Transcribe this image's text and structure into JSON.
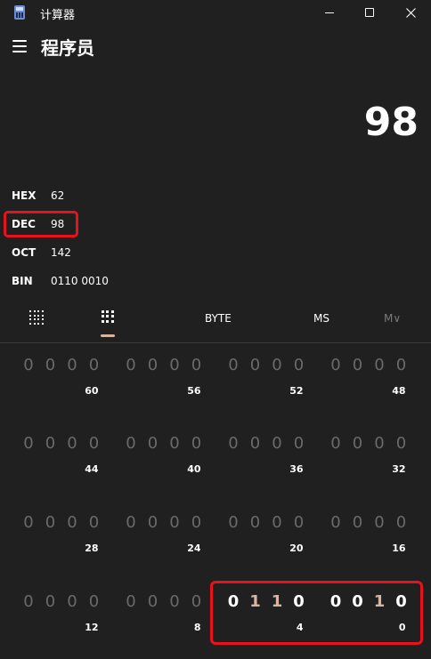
{
  "window": {
    "title": "计算器",
    "app_icon": "calculator-icon",
    "controls": [
      "minimize-icon",
      "maximize-icon",
      "close-icon"
    ]
  },
  "header": {
    "menu_icon": "hamburger-menu-icon",
    "mode_title": "程序员"
  },
  "display": {
    "value": "98"
  },
  "radix": [
    {
      "name": "HEX",
      "value": "62"
    },
    {
      "name": "DEC",
      "value": "98"
    },
    {
      "name": "OCT",
      "value": "142"
    },
    {
      "name": "BIN",
      "value": "0110 0010"
    }
  ],
  "toolbar": {
    "keypad_icon": "full-keypad-icon",
    "bit_toggle_icon": "bit-toggling-keypad-icon",
    "word_size": "BYTE",
    "memory_store": "MS",
    "memory_menu": "M∨"
  },
  "bit_grid": {
    "rows": [
      {
        "groups": [
          {
            "bits": [
              "0",
              "0",
              "0",
              "0"
            ],
            "label": "60"
          },
          {
            "bits": [
              "0",
              "0",
              "0",
              "0"
            ],
            "label": "56"
          },
          {
            "bits": [
              "0",
              "0",
              "0",
              "0"
            ],
            "label": "52"
          },
          {
            "bits": [
              "0",
              "0",
              "0",
              "0"
            ],
            "label": "48"
          }
        ]
      },
      {
        "groups": [
          {
            "bits": [
              "0",
              "0",
              "0",
              "0"
            ],
            "label": "44"
          },
          {
            "bits": [
              "0",
              "0",
              "0",
              "0"
            ],
            "label": "40"
          },
          {
            "bits": [
              "0",
              "0",
              "0",
              "0"
            ],
            "label": "36"
          },
          {
            "bits": [
              "0",
              "0",
              "0",
              "0"
            ],
            "label": "32"
          }
        ]
      },
      {
        "groups": [
          {
            "bits": [
              "0",
              "0",
              "0",
              "0"
            ],
            "label": "28"
          },
          {
            "bits": [
              "0",
              "0",
              "0",
              "0"
            ],
            "label": "24"
          },
          {
            "bits": [
              "0",
              "0",
              "0",
              "0"
            ],
            "label": "20"
          },
          {
            "bits": [
              "0",
              "0",
              "0",
              "0"
            ],
            "label": "16"
          }
        ]
      },
      {
        "groups": [
          {
            "bits": [
              "0",
              "0",
              "0",
              "0"
            ],
            "label": "12"
          },
          {
            "bits": [
              "0",
              "0",
              "0",
              "0"
            ],
            "label": "8"
          },
          {
            "bits": [
              "0",
              "1",
              "1",
              "0"
            ],
            "label": "4"
          },
          {
            "bits": [
              "0",
              "0",
              "1",
              "0"
            ],
            "label": "0"
          }
        ]
      }
    ]
  },
  "colors": {
    "background": "#202020",
    "highlight": "#e8121d",
    "accent": "#d9b5a0",
    "inactive_bit": "#6a6a6a"
  }
}
